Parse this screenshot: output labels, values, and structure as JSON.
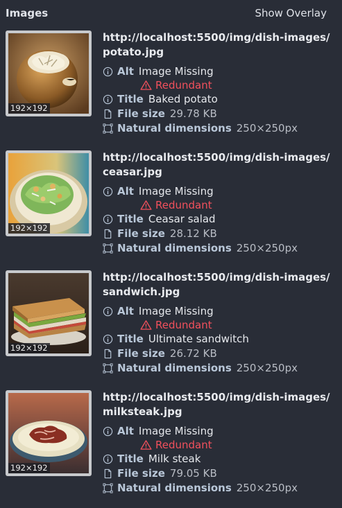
{
  "header": {
    "title": "Images",
    "overlay_label": "Show Overlay"
  },
  "labels": {
    "alt": "Alt",
    "title": "Title",
    "file_size": "File size",
    "natural_dimensions": "Natural dimensions"
  },
  "images": [
    {
      "url": "http://localhost:5500/img/dish-images/potato.jpg",
      "rendered_size": "192×192",
      "alt": "Image Missing",
      "alt_warning": "Redundant",
      "title": "Baked potato",
      "file_size": "29.78 KB",
      "natural_dimensions": "250×250px",
      "thumbnail_icon": "baked-potato-thumbnail"
    },
    {
      "url": "http://localhost:5500/img/dish-images/ceasar.jpg",
      "rendered_size": "192×192",
      "alt": "Image Missing",
      "alt_warning": "Redundant",
      "title": "Ceasar salad",
      "file_size": "28.12 KB",
      "natural_dimensions": "250×250px",
      "thumbnail_icon": "caesar-salad-thumbnail"
    },
    {
      "url": "http://localhost:5500/img/dish-images/sandwich.jpg",
      "rendered_size": "192×192",
      "alt": "Image Missing",
      "alt_warning": "Redundant",
      "title": "Ultimate sandwitch",
      "file_size": "26.72 KB",
      "natural_dimensions": "250×250px",
      "thumbnail_icon": "sandwich-thumbnail"
    },
    {
      "url": "http://localhost:5500/img/dish-images/milksteak.jpg",
      "rendered_size": "192×192",
      "alt": "Image Missing",
      "alt_warning": "Redundant",
      "title": "Milk steak",
      "file_size": "79.05 KB",
      "natural_dimensions": "250×250px",
      "thumbnail_icon": "milk-steak-thumbnail"
    }
  ],
  "colors": {
    "background": "#292d37",
    "label": "#b9c7d8",
    "warning": "#f1505c"
  }
}
